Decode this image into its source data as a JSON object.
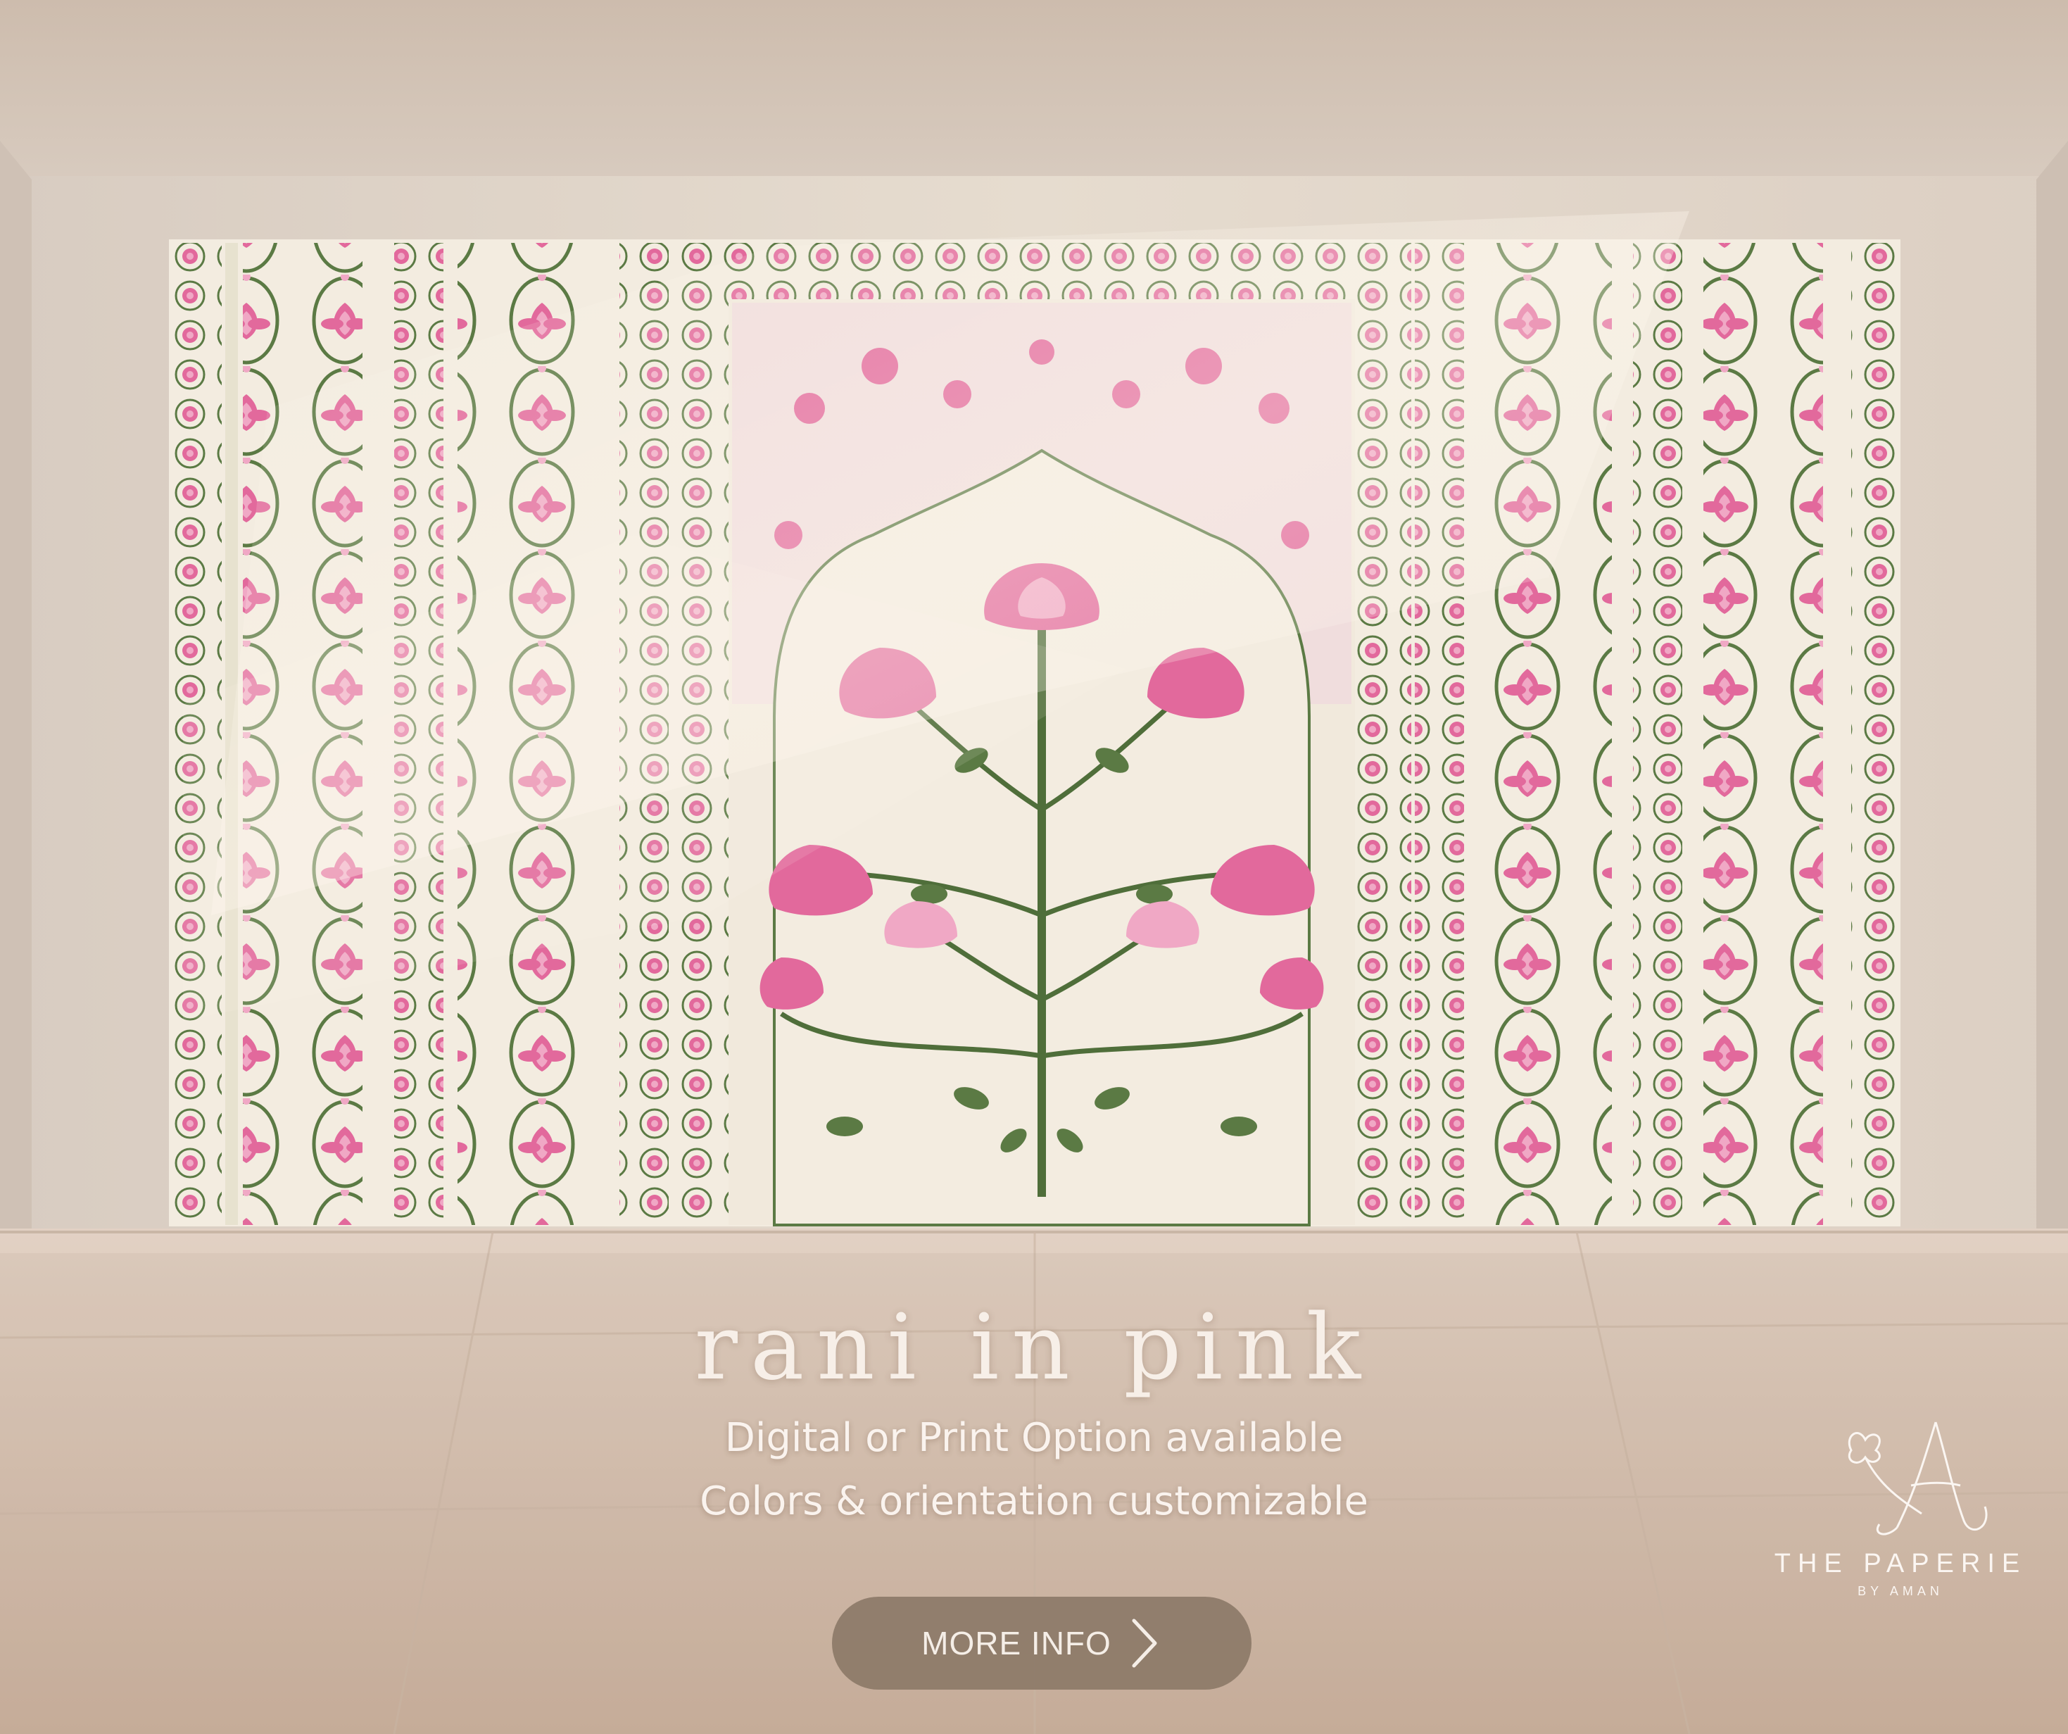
{
  "title": "rani in pink",
  "features": {
    "line1": "Digital or Print Option available",
    "line2": "Colors & orientation customizable"
  },
  "cta": {
    "label": "MORE INFO"
  },
  "brand": {
    "name": "THE PAPERIE",
    "sub": "BY AMAN"
  },
  "colors": {
    "wall": "#e4d8cc",
    "panel": "#f3ece0",
    "pink": "#e2699c",
    "pink_light": "#f0a8c5",
    "leaf": "#5b7a44",
    "floor": "#d7c2b2",
    "button": "#8c7a68"
  }
}
